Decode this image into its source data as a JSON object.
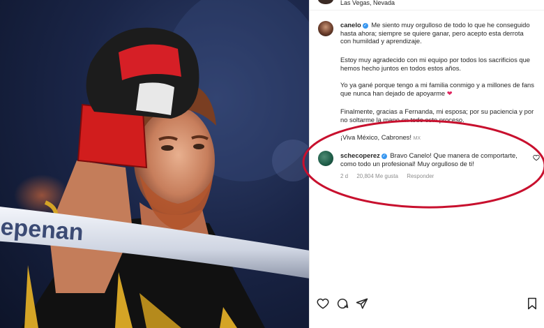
{
  "header": {
    "location": "Las Vegas, Nevada"
  },
  "caption": {
    "username": "canelo",
    "p1": "Me siento muy orgulloso de todo lo que he conseguido hasta ahora; siempre se quiere ganar, pero acepto esta derrota con humildad y aprendizaje.",
    "p2": "Estoy muy agradecido con mi equipo por todos los sacrificios que hemos hecho juntos en todos estos años.",
    "p3": "Yo ya gané porque tengo a mi familia conmigo y a millones de fans que nunca han dejado de apoyarme",
    "p4": "Finalmente, gracias a Fernanda, mi esposa; por su paciencia y por no soltarme la mano en todo este proceso.",
    "p5": "¡Viva México, Cabrones!",
    "p5_flag": "MX"
  },
  "comment": {
    "username": "schecoperez",
    "text": "Bravo Canelo! Que manera de comportarte, como todo un profesional! Muy orgulloso de ti!",
    "time": "2 d",
    "likes": "20,804 Me gusta",
    "reply": "Responder"
  },
  "photo": {
    "rope_text": "epenan"
  },
  "colors": {
    "highlight_ellipse": "#c8102e",
    "verified": "#3897f0",
    "heart": "#e0245e"
  },
  "icons": {
    "actions": [
      "heart-icon",
      "comment-icon",
      "share-icon",
      "bookmark-icon"
    ]
  }
}
